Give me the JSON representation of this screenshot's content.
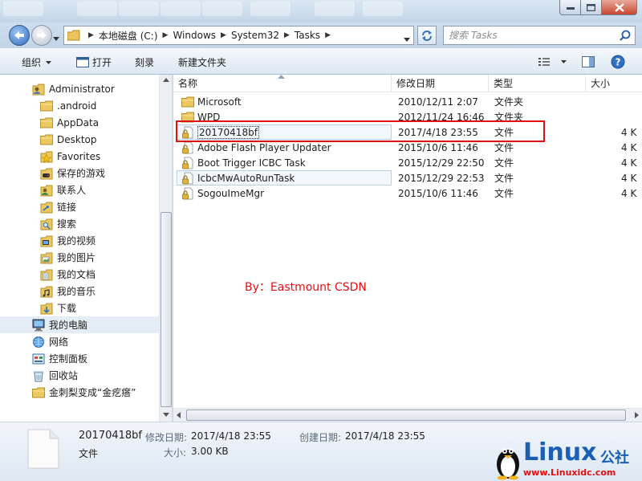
{
  "window": {
    "minimize_icon": "minimize-icon",
    "maximize_icon": "maximize-icon",
    "close_icon": "close-icon"
  },
  "address": {
    "crumbs": [
      "本地磁盘 (C:)",
      "Windows",
      "System32",
      "Tasks"
    ],
    "search_placeholder": "搜索 Tasks"
  },
  "toolbar": {
    "organize": "组织",
    "open": "打开",
    "burn": "刻录",
    "new_folder": "新建文件夹"
  },
  "nav": {
    "items": [
      {
        "label": "Administrator",
        "icon": "user-folder-icon"
      },
      {
        "label": ".android",
        "icon": "folder-icon"
      },
      {
        "label": "AppData",
        "icon": "folder-icon"
      },
      {
        "label": "Desktop",
        "icon": "folder-icon"
      },
      {
        "label": "Favorites",
        "icon": "favorites-folder-icon"
      },
      {
        "label": "保存的游戏",
        "icon": "games-folder-icon"
      },
      {
        "label": "联系人",
        "icon": "contacts-folder-icon"
      },
      {
        "label": "链接",
        "icon": "links-folder-icon"
      },
      {
        "label": "搜索",
        "icon": "search-folder-icon"
      },
      {
        "label": "我的视频",
        "icon": "videos-folder-icon"
      },
      {
        "label": "我的图片",
        "icon": "pictures-folder-icon"
      },
      {
        "label": "我的文档",
        "icon": "documents-folder-icon"
      },
      {
        "label": "我的音乐",
        "icon": "music-folder-icon"
      },
      {
        "label": "下载",
        "icon": "downloads-folder-icon"
      },
      {
        "label": "我的电脑",
        "icon": "computer-icon"
      },
      {
        "label": "网络",
        "icon": "network-icon"
      },
      {
        "label": "控制面板",
        "icon": "control-panel-icon"
      },
      {
        "label": "回收站",
        "icon": "recycle-bin-icon"
      },
      {
        "label": "金刺梨变成“金疙瘩”",
        "icon": "folder-icon"
      }
    ]
  },
  "columns": {
    "name": "名称",
    "modified": "修改日期",
    "type": "类型",
    "size": "大小"
  },
  "files": [
    {
      "name": "Microsoft",
      "modified": "2010/12/11 2:07",
      "type": "文件夹",
      "size": "",
      "icon": "folder-icon"
    },
    {
      "name": "WPD",
      "modified": "2012/11/24 16:46",
      "type": "文件夹",
      "size": "",
      "icon": "folder-icon"
    },
    {
      "name": "20170418bf",
      "modified": "2017/4/18 23:55",
      "type": "文件",
      "size": "4 K",
      "icon": "locked-file-icon"
    },
    {
      "name": "Adobe Flash Player Updater",
      "modified": "2015/10/6 11:46",
      "type": "文件",
      "size": "4 K",
      "icon": "locked-file-icon"
    },
    {
      "name": "Boot Trigger ICBC Task",
      "modified": "2015/12/29 22:50",
      "type": "文件",
      "size": "4 K",
      "icon": "locked-file-icon"
    },
    {
      "name": "IcbcMwAutoRunTask",
      "modified": "2015/12/29 22:53",
      "type": "文件",
      "size": "4 K",
      "icon": "locked-file-icon"
    },
    {
      "name": "SogouImeMgr",
      "modified": "2015/10/6 11:46",
      "type": "文件",
      "size": "4 K",
      "icon": "locked-file-icon"
    }
  ],
  "annotation": "By：Eastmount CSDN",
  "details": {
    "name": "20170418bf",
    "type": "文件",
    "modified_label": "修改日期:",
    "modified": "2017/4/18 23:55",
    "created_label": "创建日期:",
    "created": "2017/4/18 23:55",
    "size_label": "大小:",
    "size": "3.00 KB"
  },
  "logo": {
    "text": "Linux",
    "cn": "公社",
    "url": "www.Linuxidc.com"
  },
  "colors": {
    "highlight_red": "#e01010",
    "logo_blue": "#1a5fb4"
  }
}
